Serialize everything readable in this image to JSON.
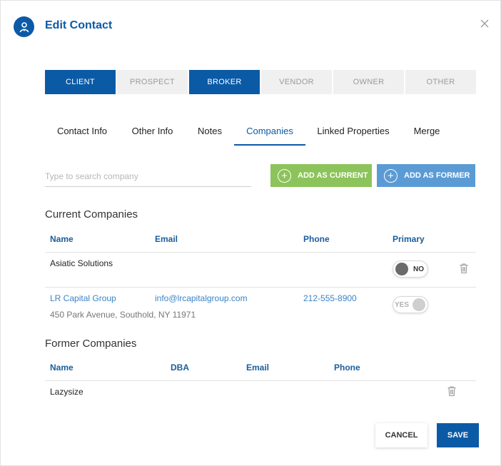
{
  "header": {
    "title": "Edit Contact",
    "icon": "contact-icon"
  },
  "types": [
    {
      "label": "CLIENT",
      "active": true
    },
    {
      "label": "PROSPECT",
      "active": false
    },
    {
      "label": "BROKER",
      "active": true
    },
    {
      "label": "VENDOR",
      "active": false
    },
    {
      "label": "OWNER",
      "active": false
    },
    {
      "label": "OTHER",
      "active": false
    }
  ],
  "tabs": [
    {
      "label": "Contact Info",
      "active": false
    },
    {
      "label": "Other Info",
      "active": false
    },
    {
      "label": "Notes",
      "active": false
    },
    {
      "label": "Companies",
      "active": true
    },
    {
      "label": "Linked Properties",
      "active": false
    },
    {
      "label": "Merge",
      "active": false
    }
  ],
  "search": {
    "placeholder": "Type to search company",
    "value": ""
  },
  "actions": {
    "add_current": "ADD AS CURRENT",
    "add_former": "ADD AS FORMER"
  },
  "current": {
    "title": "Current Companies",
    "headers": {
      "name": "Name",
      "email": "Email",
      "phone": "Phone",
      "primary": "Primary"
    },
    "rows": [
      {
        "name": "Asiatic Solutions",
        "address": "",
        "email": "",
        "phone": "",
        "primary": "NO"
      },
      {
        "name": "LR Capital Group",
        "address": "450 Park Avenue, Southold, NY 11971",
        "email": "info@lrcapitalgroup.com",
        "phone": "212-555-8900",
        "primary": "YES"
      }
    ]
  },
  "former": {
    "title": "Former Companies",
    "headers": {
      "name": "Name",
      "dba": "DBA",
      "email": "Email",
      "phone": "Phone"
    },
    "rows": [
      {
        "name": "Lazysize",
        "dba": "",
        "email": "",
        "phone": ""
      }
    ]
  },
  "footer": {
    "cancel": "CANCEL",
    "save": "SAVE"
  },
  "colors": {
    "primary": "#0b5aa6",
    "add_current": "#8cc35a",
    "add_former": "#5b9bd5",
    "link": "#3a83c7"
  }
}
